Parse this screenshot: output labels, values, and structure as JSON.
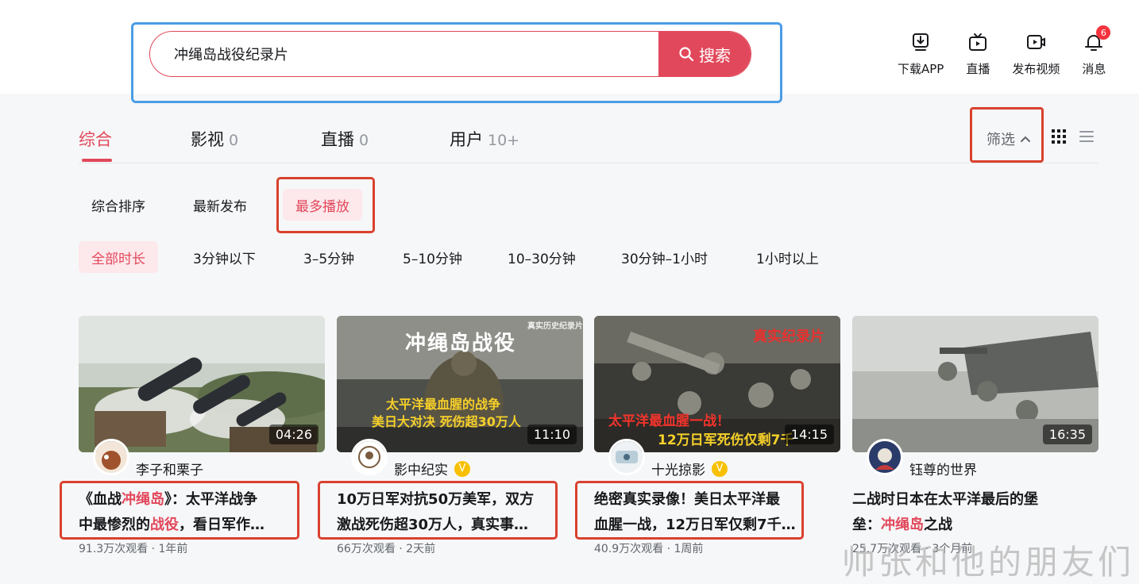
{
  "search": {
    "query": "冲绳岛战役纪录片",
    "button_label": "搜索"
  },
  "header": {
    "tools": [
      {
        "label": "下载APP",
        "icon": "download-icon"
      },
      {
        "label": "直播",
        "icon": "tv-icon"
      },
      {
        "label": "发布视频",
        "icon": "upload-video-icon"
      },
      {
        "label": "消息",
        "icon": "bell-icon",
        "badge": "6"
      }
    ]
  },
  "tabs": [
    {
      "label": "综合",
      "count": "",
      "active": true
    },
    {
      "label": "影视",
      "count": "0"
    },
    {
      "label": "直播",
      "count": "0"
    },
    {
      "label": "用户",
      "count": "10+"
    }
  ],
  "filter": {
    "label": "筛选"
  },
  "sort_options": [
    "综合排序",
    "最新发布",
    "最多播放"
  ],
  "sort_active": "最多播放",
  "duration_options": [
    "全部时长",
    "3分钟以下",
    "3–5分钟",
    "5–10分钟",
    "10–30分钟",
    "30分钟–1小时",
    "1小时以上"
  ],
  "duration_active": "全部时长",
  "videos": [
    {
      "duration": "04:26",
      "author": "李子和栗子",
      "verified": false,
      "title_l1a": "《血战",
      "title_l1b": "冲绳岛",
      "title_l1c": "》：太平洋战争",
      "title_l2a": "中最惨烈的",
      "title_l2b": "战役",
      "title_l2c": "，看日军作…",
      "meta": "91.3万次观看 · 1年前"
    },
    {
      "duration": "11:10",
      "author": "影中纪实",
      "verified": true,
      "thumb_title": "冲绳岛战役",
      "thumb_tag": "真实历史纪录片",
      "thumb_line1": "太平洋最血腥的战争",
      "thumb_line2": "美日大对决 死伤超30万人",
      "title_l1a": "10万日军对抗50万美军，双方",
      "title_l1b": "",
      "title_l1c": "",
      "title_l2a": "激战死伤超30万人，真实事…",
      "title_l2b": "",
      "title_l2c": "",
      "meta": "66万次观看 · 2天前"
    },
    {
      "duration": "14:15",
      "author": "十光掠影",
      "verified": true,
      "thumb_tag": "真实纪录片",
      "thumb_line1": "太平洋最血腥一战！",
      "thumb_line2": "12万日军死伤仅剩7千",
      "title_l1a": "绝密真实录像！美日太平洋最",
      "title_l1b": "",
      "title_l1c": "",
      "title_l2a": "血腥一战，12万日军仅剩7千…",
      "title_l2b": "",
      "title_l2c": "",
      "meta": "40.9万次观看 · 1周前"
    },
    {
      "duration": "16:35",
      "author": "钰尊的世界",
      "verified": false,
      "title_l1a": "二战时日本在太平洋最后的堡",
      "title_l1b": "",
      "title_l1c": "",
      "title_l2a": "垒：",
      "title_l2b": "冲绳岛",
      "title_l2c": "之战",
      "meta": "25.7万次观看 · 3个月前"
    }
  ],
  "watermark": "帅张和他的朋友们",
  "colors": {
    "accent": "#e2485b",
    "highlight_box": "#d9412e",
    "search_outline": "#4a9de6"
  }
}
